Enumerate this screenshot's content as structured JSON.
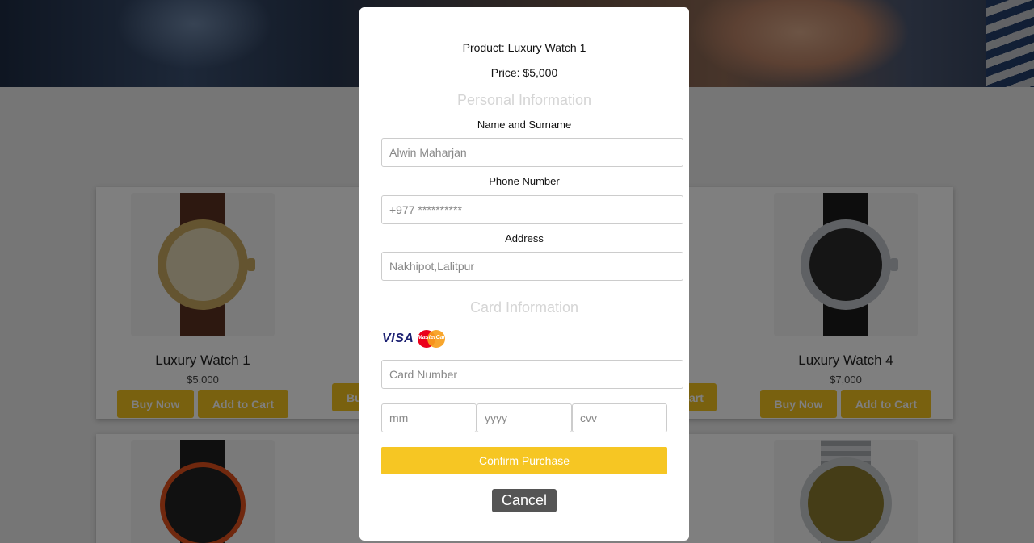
{
  "products": [
    {
      "name": "Luxury Watch 1",
      "price": "$5,000",
      "buy_label": "Buy Now",
      "cart_label": "Add to Cart",
      "dial_color": "#d8c9a2",
      "strap_color": "#5a3020",
      "case_color": "#c9a860"
    },
    {
      "name": "Luxury Watch 4",
      "price": "$7,000",
      "buy_label": "Buy Now",
      "cart_label": "Add to Cart",
      "dial_color": "#2b2b2b",
      "strap_color": "#1b1b1b",
      "case_color": "#bfc3c8"
    }
  ],
  "partial_buttons": {
    "left_fragment": "Bu",
    "right_fragment": "art"
  },
  "modal": {
    "product_line": "Product: Luxury Watch 1",
    "price_line": "Price: $5,000",
    "personal_heading": "Personal Information",
    "name_label": "Name and Surname",
    "name_placeholder": "Alwin Maharjan",
    "phone_label": "Phone Number",
    "phone_placeholder": "+977 **********",
    "address_label": "Address",
    "address_placeholder": "Nakhipot,Lalitpur",
    "card_heading": "Card Information",
    "visa_text": "VISA",
    "mastercard_text": "MasterCard",
    "card_number_placeholder": "Card Number",
    "month_placeholder": "mm",
    "year_placeholder": "yyyy",
    "cvv_placeholder": "cvv",
    "confirm_label": "Confirm Purchase",
    "cancel_label": "Cancel"
  },
  "colors": {
    "accent": "#f6c623",
    "cancel": "#555555",
    "section_heading": "#d5d5d5"
  }
}
